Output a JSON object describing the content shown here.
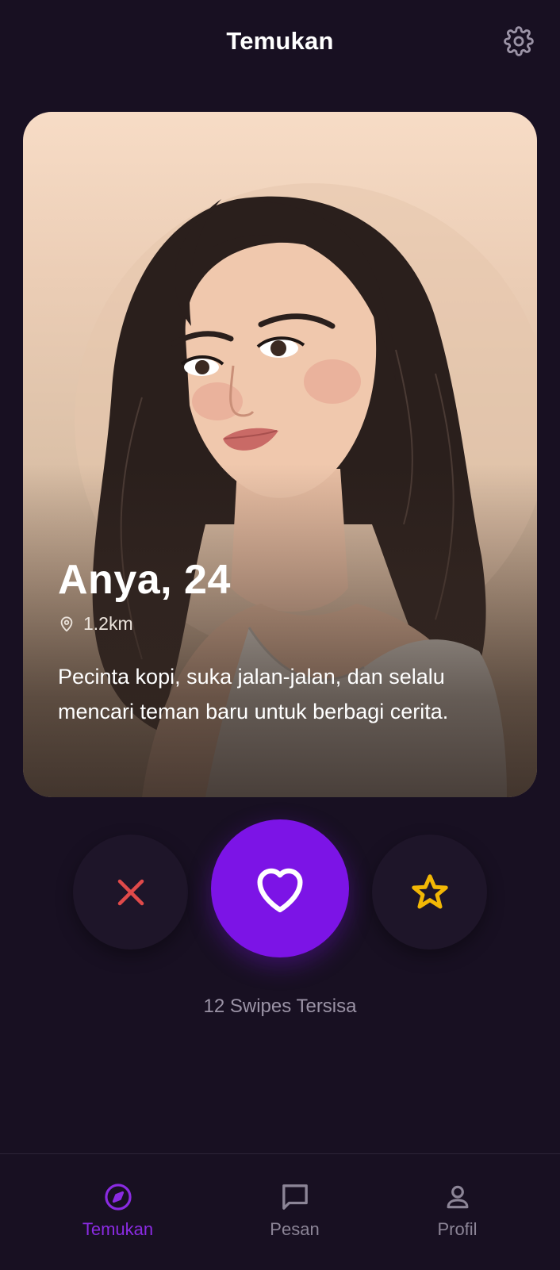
{
  "header": {
    "title": "Temukan",
    "settings_icon": "gear-icon"
  },
  "profile": {
    "name_age": "Anya, 24",
    "distance": "1.2km",
    "bio": "Pecinta kopi, suka jalan-jalan, dan selalu mencari teman baru untuk berbagi cerita."
  },
  "actions": {
    "nope_icon": "close-icon",
    "like_icon": "heart-icon",
    "superlike_icon": "star-icon",
    "swipes_remaining": "12 Swipes Tersisa"
  },
  "nav": {
    "items": [
      {
        "label": "Temukan",
        "icon": "compass-icon",
        "active": true
      },
      {
        "label": "Pesan",
        "icon": "chat-icon",
        "active": false
      },
      {
        "label": "Profil",
        "icon": "user-icon",
        "active": false
      }
    ]
  },
  "colors": {
    "background": "#181022",
    "accent": "#7c14e6",
    "nope": "#e04a4a",
    "star": "#f2b705",
    "muted": "#8c8597"
  }
}
